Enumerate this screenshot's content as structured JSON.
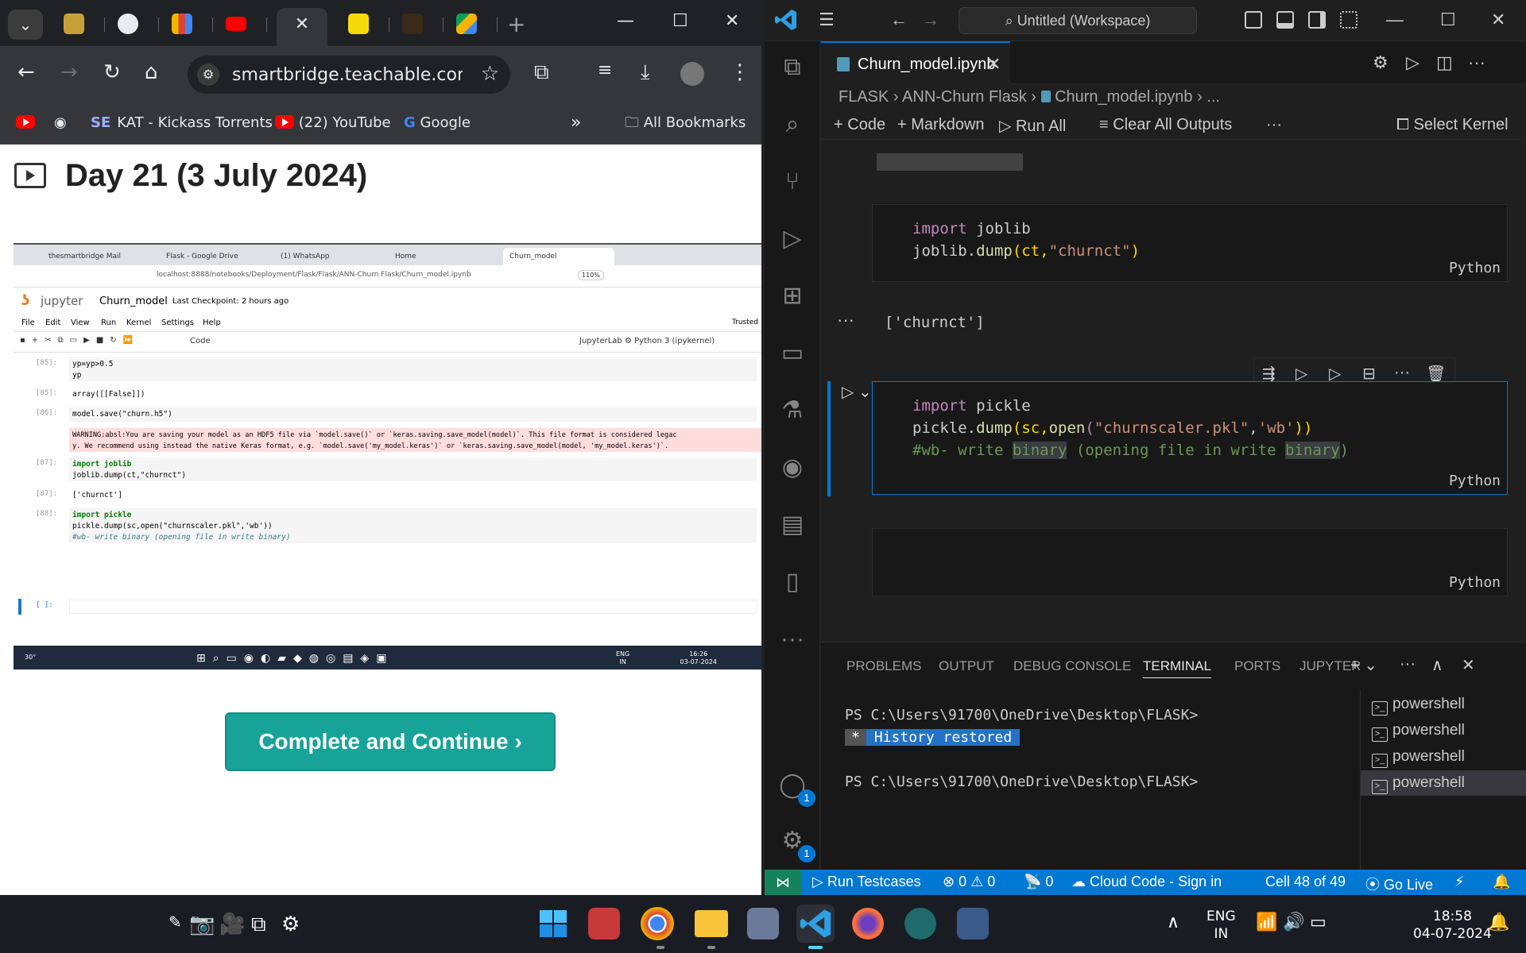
{
  "chrome": {
    "url": "smartbridge.teachable.com/c...",
    "bookmarks": {
      "kat": "KAT - Kickass Torrents",
      "youtube": "(22) YouTube",
      "google": "Google",
      "more": "»",
      "all": "All Bookmarks"
    },
    "page": {
      "lesson_title": "Day 21 (3 July 2024)",
      "complete_button": "Complete and Continue  ›"
    },
    "embedded": {
      "tabs": [
        "thesmartbridge Mail",
        "Flask - Google Drive",
        "(1) WhatsApp",
        "Home",
        "Churn_model"
      ],
      "url": "localhost:8888/notebooks/Deployment/Flask/Flask/ANN-Churn Flask/Churn_model.ipynb",
      "zoom": "110%",
      "app_name": "jupyter",
      "notebook_name": "Churn_model",
      "checkpoint": "Last Checkpoint: 2 hours ago",
      "menu": [
        "File",
        "Edit",
        "View",
        "Run",
        "Kernel",
        "Settings",
        "Help"
      ],
      "trusted": "Trusted",
      "cell_type": "Code",
      "jupyterlab": "JupyterLab",
      "kernel": "Python 3 (ipykernel)",
      "cells": [
        {
          "prompt": "[85]:",
          "line1": "yp=yp>0.5",
          "line2": "yp"
        },
        {
          "prompt": "[85]:",
          "output": "array([[False]])"
        },
        {
          "prompt": "[86]:",
          "code": "model.save(\"churn.h5\")"
        },
        {
          "warn1": "WARNING:absl:You are saving your model as an HDF5 file via `model.save()` or `keras.saving.save_model(model)`. This file format is considered legac",
          "warn2": "y. We recommend using instead the native Keras format, e.g. `model.save('my_model.keras')` or `keras.saving.save_model(model, 'my_model.keras')`."
        },
        {
          "prompt": "[87]:",
          "line1": "import joblib",
          "line2": "joblib.dump(ct,\"churnct\")"
        },
        {
          "prompt": "[87]:",
          "output": "['churnct']"
        },
        {
          "prompt": "[88]:",
          "line1": "import pickle",
          "line2": "pickle.dump(sc,open(\"churnscaler.pkl\",'wb'))",
          "line3": "#wb- write binary (opening file in write binary)"
        },
        {
          "prompt": "[ ]:"
        }
      ],
      "taskbar_temp": "30°",
      "taskbar_lang1": "ENG",
      "taskbar_lang2": "IN",
      "taskbar_time": "16:26",
      "taskbar_date": "03-07-2024"
    }
  },
  "vscode": {
    "search_title": "Untitled (Workspace)",
    "tab_name": "Churn_model.ipynb",
    "breadcrumb": [
      "FLASK",
      "ANN-Churn Flask",
      "Churn_model.ipynb",
      "..."
    ],
    "toolbar": {
      "code": "Code",
      "markdown": "Markdown",
      "run_all": "Run All",
      "clear_outputs": "Clear All Outputs",
      "more": "···",
      "select_kernel": "Select Kernel"
    },
    "cells": {
      "c1_line1_kw": "import",
      "c1_line1_mod": " joblib",
      "c1_line2_a": "joblib.",
      "c1_line2_fn": "dump",
      "c1_line2_b": "(ct,",
      "c1_line2_str": "\"churnct\"",
      "c1_line2_c": ")",
      "output": "['churnct']",
      "c2_line1_kw": "import",
      "c2_line1_mod": " pickle",
      "c2_line2_a": "pickle.",
      "c2_line2_fn": "dump",
      "c2_line2_b": "(sc,",
      "c2_line2_fn2": "open",
      "c2_line2_c": "(",
      "c2_line2_str1": "\"churnscaler.pkl\"",
      "c2_line2_d": ",",
      "c2_line2_str2": "'wb'",
      "c2_line2_e": "))",
      "c2_line3_a": "#wb- write ",
      "c2_line3_hl1": "binary",
      "c2_line3_b": " (opening file in write ",
      "c2_line3_hl2": "binary",
      "c2_line3_c": ")",
      "lang": "Python"
    },
    "panel": {
      "tabs": [
        "PROBLEMS",
        "OUTPUT",
        "DEBUG CONSOLE",
        "TERMINAL",
        "PORTS",
        "JUPYTER"
      ],
      "prompt1": "PS C:\\Users\\91700\\OneDrive\\Desktop\\FLASK>",
      "history_star": "*",
      "history": "History restored",
      "prompt2": "PS C:\\Users\\91700\\OneDrive\\Desktop\\FLASK>",
      "terminals": [
        "powershell",
        "powershell",
        "powershell",
        "powershell"
      ]
    },
    "status": {
      "run_testcases": "Run Testcases",
      "errors": "0",
      "warnings": "0",
      "ports": "0",
      "cloud_code": "Cloud Code - Sign in",
      "cell": "Cell 48 of 49",
      "go_live": "Go Live"
    },
    "badges": {
      "accounts": "1",
      "manage": "1"
    }
  },
  "taskbar": {
    "lang1": "ENG",
    "lang2": "IN",
    "time": "18:58",
    "date": "04-07-2024"
  },
  "colors": {
    "vscode_accent": "#0078d4",
    "complete_button": "#17a398",
    "chrome_bg": "#202124"
  }
}
